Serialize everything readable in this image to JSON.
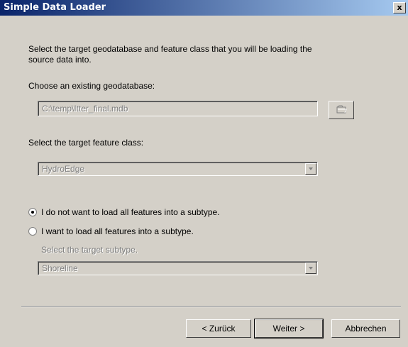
{
  "window": {
    "title": "Simple Data Loader",
    "close_glyph": "x"
  },
  "intro": {
    "line1": "Select the target geodatabase and feature class that you will be loading the",
    "line2": "source data into."
  },
  "geodatabase": {
    "label": "Choose an existing geodatabase:",
    "value": "C:\\temp\\Itter_final.mdb",
    "browse_icon": "folder-open-icon"
  },
  "feature_class": {
    "label": "Select the target feature class:",
    "value": "HydroEdge"
  },
  "subtype": {
    "option1": "I do not want to load all features into a subtype.",
    "option2": "I want to load all features into a subtype.",
    "selected": 1,
    "label": "Select the target subtype.",
    "value": "Shoreline"
  },
  "buttons": {
    "back": "< Zurück",
    "next": "Weiter >",
    "cancel": "Abbrechen"
  }
}
